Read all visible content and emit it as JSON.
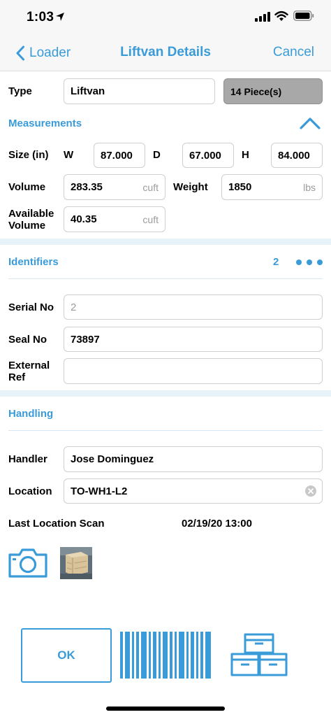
{
  "status_bar": {
    "time": "1:03"
  },
  "nav": {
    "back_label": "Loader",
    "title": "Liftvan Details",
    "cancel_label": "Cancel"
  },
  "type_row": {
    "label": "Type",
    "value": "Liftvan",
    "pieces_label": "14 Piece(s)"
  },
  "measurements": {
    "title": "Measurements",
    "size_label": "Size (in)",
    "w_label": "W",
    "w_value": "87.000",
    "d_label": "D",
    "d_value": "67.000",
    "h_label": "H",
    "h_value": "84.000",
    "volume_label": "Volume",
    "volume_value": "283.35",
    "volume_unit": "cuft",
    "weight_label": "Weight",
    "weight_value": "1850",
    "weight_unit": "lbs",
    "avail_label_line1": "Available",
    "avail_label_line2": "Volume",
    "avail_value": "40.35",
    "avail_unit": "cuft"
  },
  "identifiers": {
    "title": "Identifiers",
    "count": "2",
    "serial_label": "Serial No",
    "serial_placeholder": "2",
    "seal_label": "Seal No",
    "seal_value": "73897",
    "ext_label_line1": "External",
    "ext_label_line2": "Ref",
    "ext_value": ""
  },
  "handling": {
    "title": "Handling",
    "handler_label": "Handler",
    "handler_value": "Jose Dominguez",
    "location_label": "Location",
    "location_value": "TO-WH1-L2",
    "last_scan_label": "Last Location Scan",
    "last_scan_value": "02/19/20 13:00"
  },
  "footer": {
    "ok_label": "OK"
  },
  "icons": {
    "back": "chevron-left-icon",
    "collapse": "chevron-up-icon",
    "more": "more-dots-icon",
    "clear": "clear-circle-icon",
    "camera": "camera-icon",
    "barcode": "barcode-icon",
    "stack": "stack-boxes-icon"
  },
  "colors": {
    "accent": "#3a9bd9",
    "pieces_button": "#a8a8a8",
    "band": "#e8f2f9",
    "unit_text": "#9b9b9b"
  }
}
